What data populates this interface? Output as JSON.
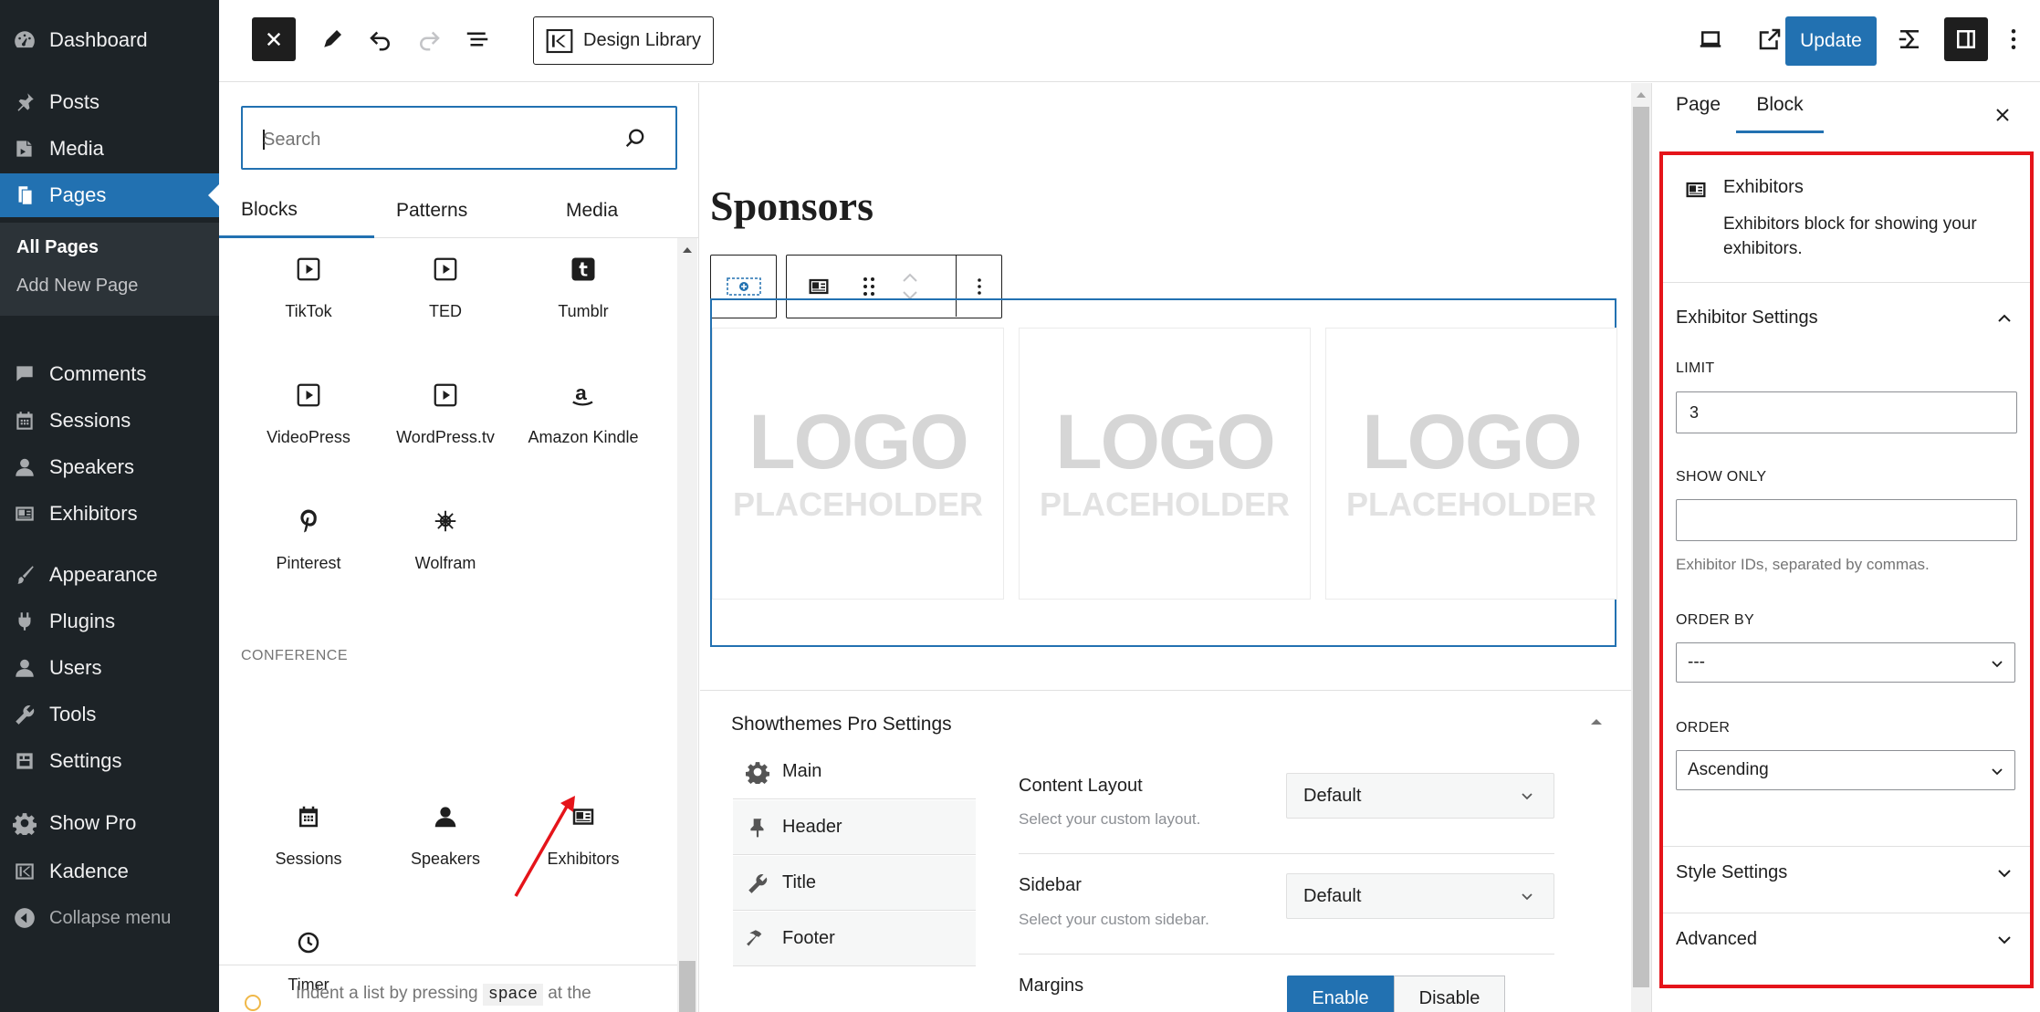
{
  "wp_menu": {
    "items": [
      {
        "label": "Dashboard",
        "icon": "dashboard-icon"
      },
      {
        "label": "Posts",
        "icon": "pin-icon"
      },
      {
        "label": "Media",
        "icon": "media-icon"
      },
      {
        "label": "Pages",
        "icon": "pages-icon"
      },
      {
        "label": "Comments",
        "icon": "comments-icon"
      },
      {
        "label": "Sessions",
        "icon": "calendar-icon"
      },
      {
        "label": "Speakers",
        "icon": "user-icon"
      },
      {
        "label": "Exhibitors",
        "icon": "id-card-icon"
      },
      {
        "label": "Appearance",
        "icon": "brush-icon"
      },
      {
        "label": "Plugins",
        "icon": "plug-icon"
      },
      {
        "label": "Users",
        "icon": "users-icon"
      },
      {
        "label": "Tools",
        "icon": "wrench-icon"
      },
      {
        "label": "Settings",
        "icon": "settings-icon"
      },
      {
        "label": "Show Pro",
        "icon": "gear-icon"
      },
      {
        "label": "Kadence",
        "icon": "kadence-icon"
      },
      {
        "label": "Collapse menu",
        "icon": "collapse-icon"
      }
    ],
    "submenu": {
      "all_pages": "All Pages",
      "add_new_page": "Add New Page"
    }
  },
  "toolbar": {
    "design_library": "Design Library",
    "update": "Update"
  },
  "inserter": {
    "search_placeholder": "Search",
    "tabs": {
      "blocks": "Blocks",
      "patterns": "Patterns",
      "media": "Media"
    },
    "embeds": [
      {
        "label": "TikTok",
        "icon": "video-embed-icon"
      },
      {
        "label": "TED",
        "icon": "video-embed-icon"
      },
      {
        "label": "Tumblr",
        "icon": "tumblr-icon"
      },
      {
        "label": "VideoPress",
        "icon": "video-embed-icon"
      },
      {
        "label": "WordPress.tv",
        "icon": "video-embed-icon"
      },
      {
        "label": "Amazon Kindle",
        "icon": "amazon-icon"
      },
      {
        "label": "Pinterest",
        "icon": "pinterest-icon"
      },
      {
        "label": "Wolfram",
        "icon": "wolfram-icon"
      }
    ],
    "conference_heading": "CONFERENCE",
    "conference": [
      {
        "label": "Sessions",
        "icon": "calendar-icon"
      },
      {
        "label": "Speakers",
        "icon": "user-icon"
      },
      {
        "label": "Exhibitors",
        "icon": "id-card-icon"
      },
      {
        "label": "Timer",
        "icon": "clock-icon"
      }
    ],
    "tip": {
      "before": "Indent a list by pressing",
      "key": "space",
      "after": "at the"
    }
  },
  "canvas": {
    "heading": "Sponsors",
    "logo_line1": "LOGO",
    "logo_line2": "PLACEHOLDER"
  },
  "meta_box": {
    "title": "Showthemes Pro Settings",
    "tabs": [
      {
        "label": "Main",
        "icon": "gear-icon"
      },
      {
        "label": "Header",
        "icon": "pin-icon"
      },
      {
        "label": "Title",
        "icon": "wrench-icon"
      },
      {
        "label": "Footer",
        "icon": "hammer-icon"
      }
    ],
    "content_layout": {
      "label": "Content Layout",
      "desc": "Select your custom layout.",
      "value": "Default"
    },
    "sidebar": {
      "label": "Sidebar",
      "desc": "Select your custom sidebar.",
      "value": "Default"
    },
    "margins": {
      "label": "Margins",
      "enable": "Enable",
      "disable": "Disable"
    }
  },
  "settings": {
    "tabs": {
      "page": "Page",
      "block": "Block"
    },
    "block_card": {
      "title": "Exhibitors",
      "desc": "Exhibitors block for showing your exhibitors."
    },
    "exhibitor_settings": {
      "title": "Exhibitor Settings",
      "limit_label": "LIMIT",
      "limit_value": "3",
      "show_only_label": "SHOW ONLY",
      "show_only_value": "",
      "show_only_help": "Exhibitor IDs, separated by commas.",
      "order_by_label": "ORDER BY",
      "order_by_value": "---",
      "order_label": "ORDER",
      "order_value": "Ascending"
    },
    "style_settings": "Style Settings",
    "advanced": "Advanced"
  },
  "colors": {
    "accent": "#2271b1",
    "admin_bg": "#1d2327",
    "highlight": "#e5141a"
  }
}
